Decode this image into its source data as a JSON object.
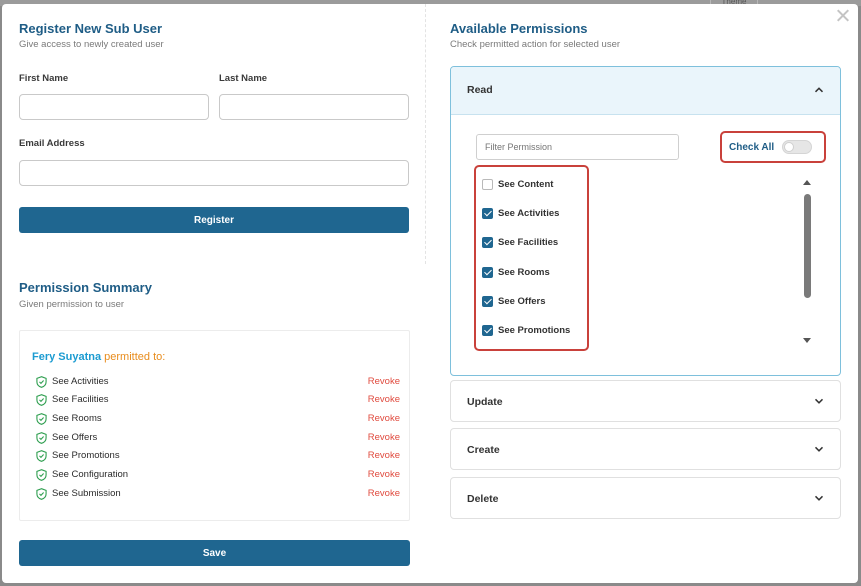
{
  "backdrop": {
    "tab_label": "Theme"
  },
  "register": {
    "title": "Register New Sub User",
    "subtitle": "Give access to newly created user",
    "first_name_label": "First Name",
    "first_name_value": "",
    "last_name_label": "Last Name",
    "last_name_value": "",
    "email_label": "Email Address",
    "email_value": "",
    "register_button": "Register"
  },
  "summary": {
    "title": "Permission Summary",
    "subtitle": "Given permission to user",
    "user_name": "Fery Suyatna",
    "permitted_text": "permitted to:",
    "revoke_label": "Revoke",
    "items": [
      "See Activities",
      "See Facilities",
      "See Rooms",
      "See Offers",
      "See Promotions",
      "See Configuration",
      "See Submission"
    ],
    "save_button": "Save"
  },
  "permissions": {
    "title": "Available Permissions",
    "subtitle": "Check permitted action for selected user",
    "read": {
      "label": "Read",
      "filter_placeholder": "Filter Permission",
      "check_all_label": "Check All",
      "check_all_on": false,
      "items": [
        {
          "label": "See Content",
          "checked": false
        },
        {
          "label": "See Activities",
          "checked": true
        },
        {
          "label": "See Facilities",
          "checked": true
        },
        {
          "label": "See Rooms",
          "checked": true
        },
        {
          "label": "See Offers",
          "checked": true
        },
        {
          "label": "See Promotions",
          "checked": true
        }
      ]
    },
    "update_label": "Update",
    "create_label": "Create",
    "delete_label": "Delete"
  },
  "colors": {
    "primary": "#1f6690",
    "title": "#1f5d86",
    "highlight_border": "#c9413b",
    "revoke": "#e04b3f",
    "user_name": "#1b9bd1",
    "permitted": "#e88c1c",
    "shield": "#2e9e4f"
  }
}
